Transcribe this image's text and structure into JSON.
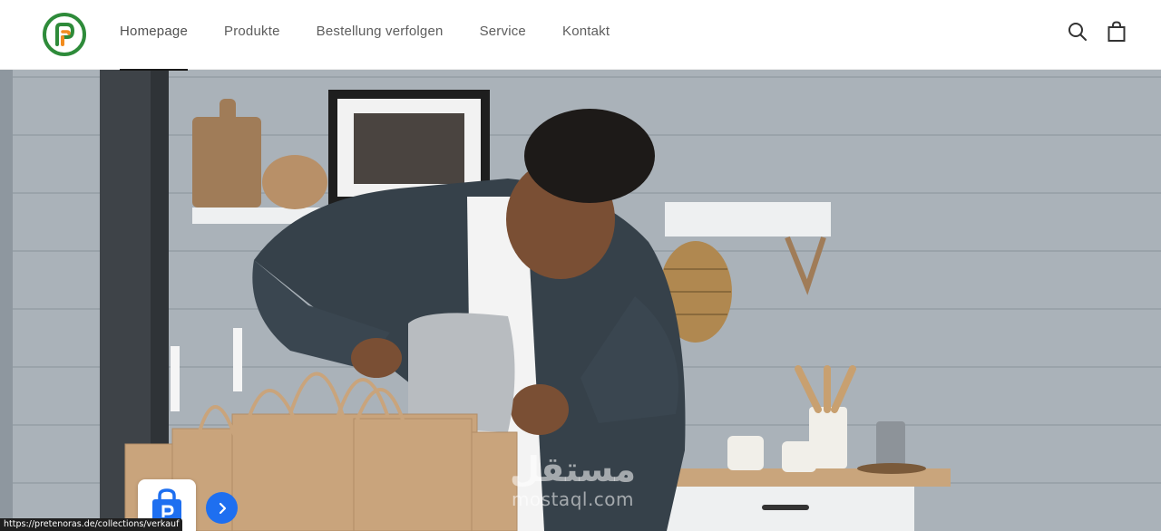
{
  "header": {
    "logo_name": "brand-logo",
    "nav": [
      {
        "label": "Homepage",
        "active": true
      },
      {
        "label": "Produkte",
        "active": false
      },
      {
        "label": "Bestellung verfolgen",
        "active": false
      },
      {
        "label": "Service",
        "active": false
      },
      {
        "label": "Kontakt",
        "active": false
      }
    ],
    "icons": [
      "search-icon",
      "shopping-bag-icon"
    ]
  },
  "hero": {
    "image": "man-packing-paper-bags-in-kitchen"
  },
  "overlays": {
    "status_url": "https://pretenoras.de/collections/verkauf",
    "watermark_arabic": "مستقل",
    "watermark_latin": "mostaql.com"
  },
  "colors": {
    "accent_blue": "#1e6ff0",
    "logo_green": "#2e8b3a",
    "logo_orange": "#f28c1e",
    "wall": "#a9b1b8"
  }
}
